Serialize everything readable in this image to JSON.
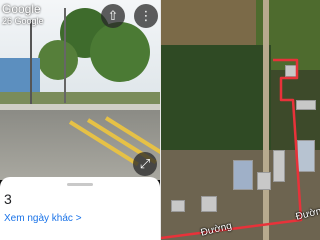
{
  "street_view": {
    "title": "Google",
    "subtitle": "26 Google",
    "number": "3",
    "link_text": "Xem ngày khác",
    "link_chevron": ">",
    "icons": {
      "back": "back-arrow-icon",
      "share": "share-icon",
      "more": "more-vertical-icon",
      "expand": "expand-icon"
    }
  },
  "map": {
    "street_label": "Đường"
  },
  "colors": {
    "route": "#e8323a",
    "link": "#1a73e8"
  }
}
